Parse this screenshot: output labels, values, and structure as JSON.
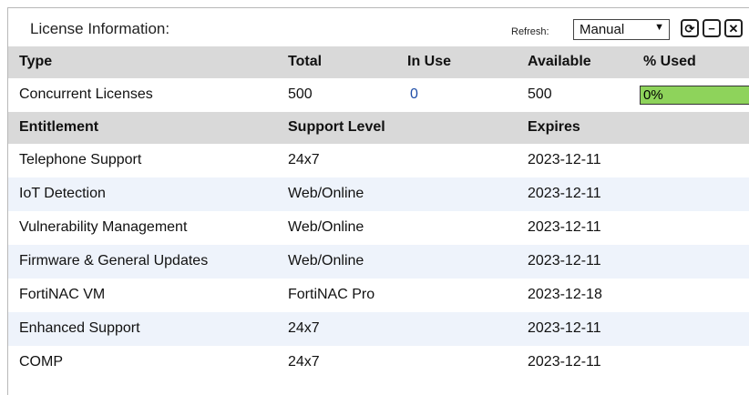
{
  "panel": {
    "title": "License Information:",
    "refresh_label": "Refresh:",
    "refresh_value": "Manual",
    "buttons": {
      "refresh": "⟳",
      "minimize": "−",
      "close": "✕"
    }
  },
  "licenses": {
    "headers": [
      "Type",
      "Total",
      "In Use",
      "Available",
      "% Used"
    ],
    "rows": [
      {
        "type": "Concurrent Licenses",
        "total": "500",
        "in_use": "0",
        "available": "500",
        "percent_used": "0%",
        "percent_value": 0.0
      }
    ]
  },
  "entitlements": {
    "headers": [
      "Entitlement",
      "Support Level",
      "Expires"
    ],
    "rows": [
      {
        "name": "Telephone Support",
        "level": "24x7",
        "expires": "2023-12-11"
      },
      {
        "name": "IoT Detection",
        "level": "Web/Online",
        "expires": "2023-12-11"
      },
      {
        "name": "Vulnerability Management",
        "level": "Web/Online",
        "expires": "2023-12-11"
      },
      {
        "name": "Firmware & General Updates",
        "level": "Web/Online",
        "expires": "2023-12-11"
      },
      {
        "name": "FortiNAC VM",
        "level": "FortiNAC Pro",
        "expires": "2023-12-18"
      },
      {
        "name": "Enhanced Support",
        "level": "24x7",
        "expires": "2023-12-11"
      },
      {
        "name": "COMP",
        "level": "24x7",
        "expires": "2023-12-11"
      }
    ]
  },
  "colors": {
    "header_bg": "#d9d9d9",
    "alt_row_bg": "#eef3fb",
    "progress_fill": "#8ed35b",
    "link": "#1f4ea8"
  }
}
